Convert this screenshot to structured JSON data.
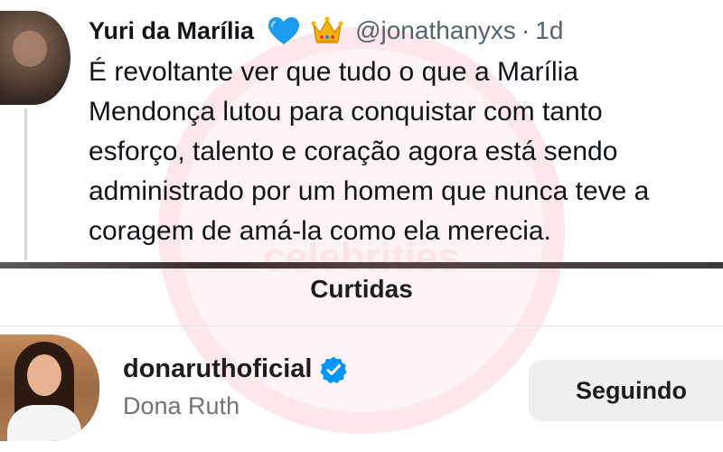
{
  "tweet": {
    "name": "Yuri da Marília",
    "handle": "@jonathanyxs",
    "separator": "·",
    "time": "1d",
    "lines": [
      "É revoltante ver que tudo o que a Marília",
      "Mendonça lutou para conquistar com tanto",
      "esforço, talento e coração agora está sendo",
      "administrado por um homem que nunca teve a",
      "coragem de amá-la como ela merecia."
    ],
    "icons": [
      "blue-heart-icon",
      "crown-icon"
    ]
  },
  "likes": {
    "title": "Curtidas"
  },
  "user": {
    "username": "donaruthoficial",
    "display_name": "Dona Ruth",
    "button_label": "Seguindo",
    "verified": true
  },
  "watermark": {
    "text": "celebrities"
  },
  "colors": {
    "heart": "#1d9bf0",
    "verified": "#0095f6",
    "handle": "#536471",
    "button_bg": "#efeff2"
  }
}
